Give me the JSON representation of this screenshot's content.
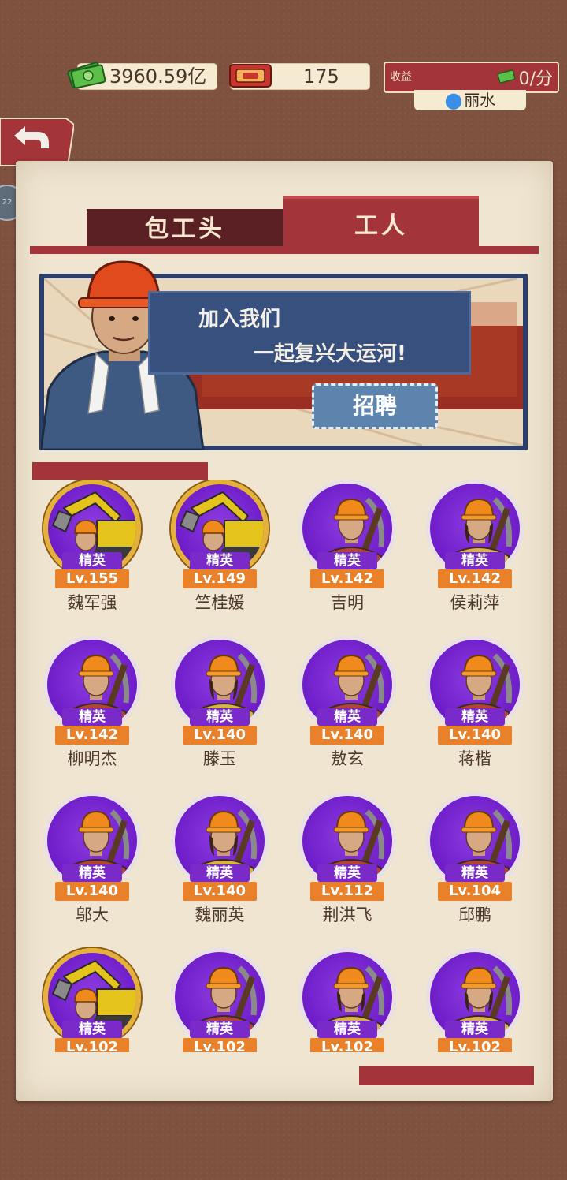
{
  "top_bar": {
    "money": "3960.59亿",
    "tickets": "175",
    "income_label": "收益",
    "income_value": "0/分",
    "location": "丽水"
  },
  "tabs": [
    {
      "label": "包工头",
      "active": false
    },
    {
      "label": "工人",
      "active": true
    }
  ],
  "banner": {
    "line1": "加入我们",
    "line2": "一起复兴大运河!",
    "button": "招聘"
  },
  "side_badge": "22",
  "workers": [
    {
      "name": "魏军强",
      "level": "Lv.155",
      "rank": "精英",
      "frame": "gold",
      "art": "excavator"
    },
    {
      "name": "竺桂媛",
      "level": "Lv.149",
      "rank": "精英",
      "frame": "gold",
      "art": "excavator"
    },
    {
      "name": "吉明",
      "level": "Lv.142",
      "rank": "精英",
      "frame": "elite",
      "art": "male"
    },
    {
      "name": "侯莉萍",
      "level": "Lv.142",
      "rank": "精英",
      "frame": "elite",
      "art": "female"
    },
    {
      "name": "柳明杰",
      "level": "Lv.142",
      "rank": "精英",
      "frame": "elite",
      "art": "male"
    },
    {
      "name": "滕玉",
      "level": "Lv.140",
      "rank": "精英",
      "frame": "elite",
      "art": "female"
    },
    {
      "name": "敖玄",
      "level": "Lv.140",
      "rank": "精英",
      "frame": "elite",
      "art": "male"
    },
    {
      "name": "蒋楷",
      "level": "Lv.140",
      "rank": "精英",
      "frame": "elite",
      "art": "male"
    },
    {
      "name": "邬大",
      "level": "Lv.140",
      "rank": "精英",
      "frame": "elite",
      "art": "male"
    },
    {
      "name": "魏丽英",
      "level": "Lv.140",
      "rank": "精英",
      "frame": "elite",
      "art": "female"
    },
    {
      "name": "荆洪飞",
      "level": "Lv.112",
      "rank": "精英",
      "frame": "elite",
      "art": "male"
    },
    {
      "name": "邱鹏",
      "level": "Lv.104",
      "rank": "精英",
      "frame": "elite",
      "art": "male"
    },
    {
      "name": "",
      "level": "Lv.102",
      "rank": "精英",
      "frame": "gold",
      "art": "excavator"
    },
    {
      "name": "",
      "level": "Lv.102",
      "rank": "精英",
      "frame": "elite",
      "art": "male"
    },
    {
      "name": "",
      "level": "Lv.102",
      "rank": "精英",
      "frame": "elite",
      "art": "female"
    },
    {
      "name": "",
      "level": "Lv.102",
      "rank": "精英",
      "frame": "elite",
      "art": "female"
    }
  ],
  "colors": {
    "accent_red": "#a3353a",
    "elite_purple": "#7a2ac8",
    "level_orange": "#e8812a",
    "gold_frame": "#e4b23a"
  }
}
